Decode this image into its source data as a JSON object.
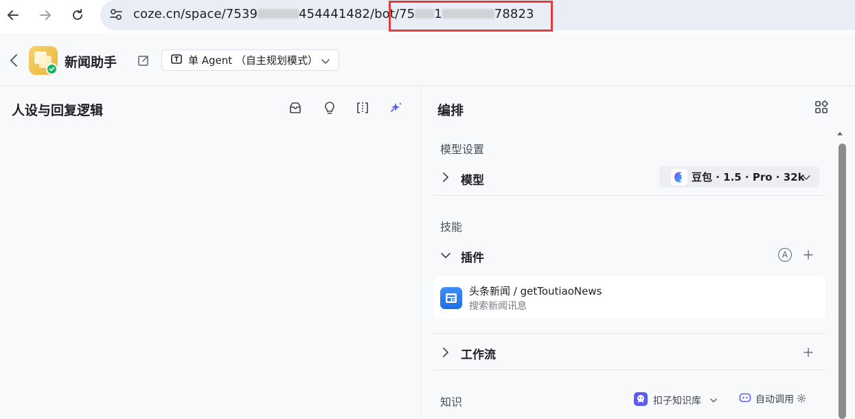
{
  "browser": {
    "url_prefix": "coze.cn/space/7539",
    "url_mid": "454441482/bot/75",
    "url_mid2": "1",
    "url_suffix": "78823"
  },
  "header": {
    "bot_name": "新闻助手",
    "mode_label": "单 Agent （自主规划模式）"
  },
  "left_panel": {
    "title": "人设与回复逻辑"
  },
  "right_panel": {
    "title": "编排",
    "model_section_label": "模型设置",
    "model_row_title": "模型",
    "model_selected": "豆包 · 1.5 · Pro · 32k",
    "skills_section_label": "技能",
    "plugins_row_title": "插件",
    "auto_badge": "A",
    "plugin": {
      "name": "头条新闻 / getToutiaoNews",
      "description": "搜索新闻讯息"
    },
    "workflow_row_title": "工作流",
    "knowledge_section_label": "知识",
    "knowledge_base_label": "扣子知识库",
    "auto_call_label": "自动调用"
  },
  "colors": {
    "highlight_box": "#e03c3c",
    "plugin_icon": "#1e6fe6",
    "check_badge": "#14b85c",
    "accent_purple": "#5b5cf0"
  },
  "icons": [
    "back-arrow-icon",
    "forward-arrow-icon",
    "reload-icon",
    "site-settings-icon",
    "edit-icon",
    "agent-mode-icon",
    "chevron-down-icon",
    "import-icon",
    "bulb-icon",
    "split-view-icon",
    "sparkle-icon",
    "grid-icon",
    "chevron-right-icon",
    "plus-icon",
    "news-plugin-icon",
    "knowledge-base-icon",
    "robot-icon",
    "gear-icon"
  ]
}
